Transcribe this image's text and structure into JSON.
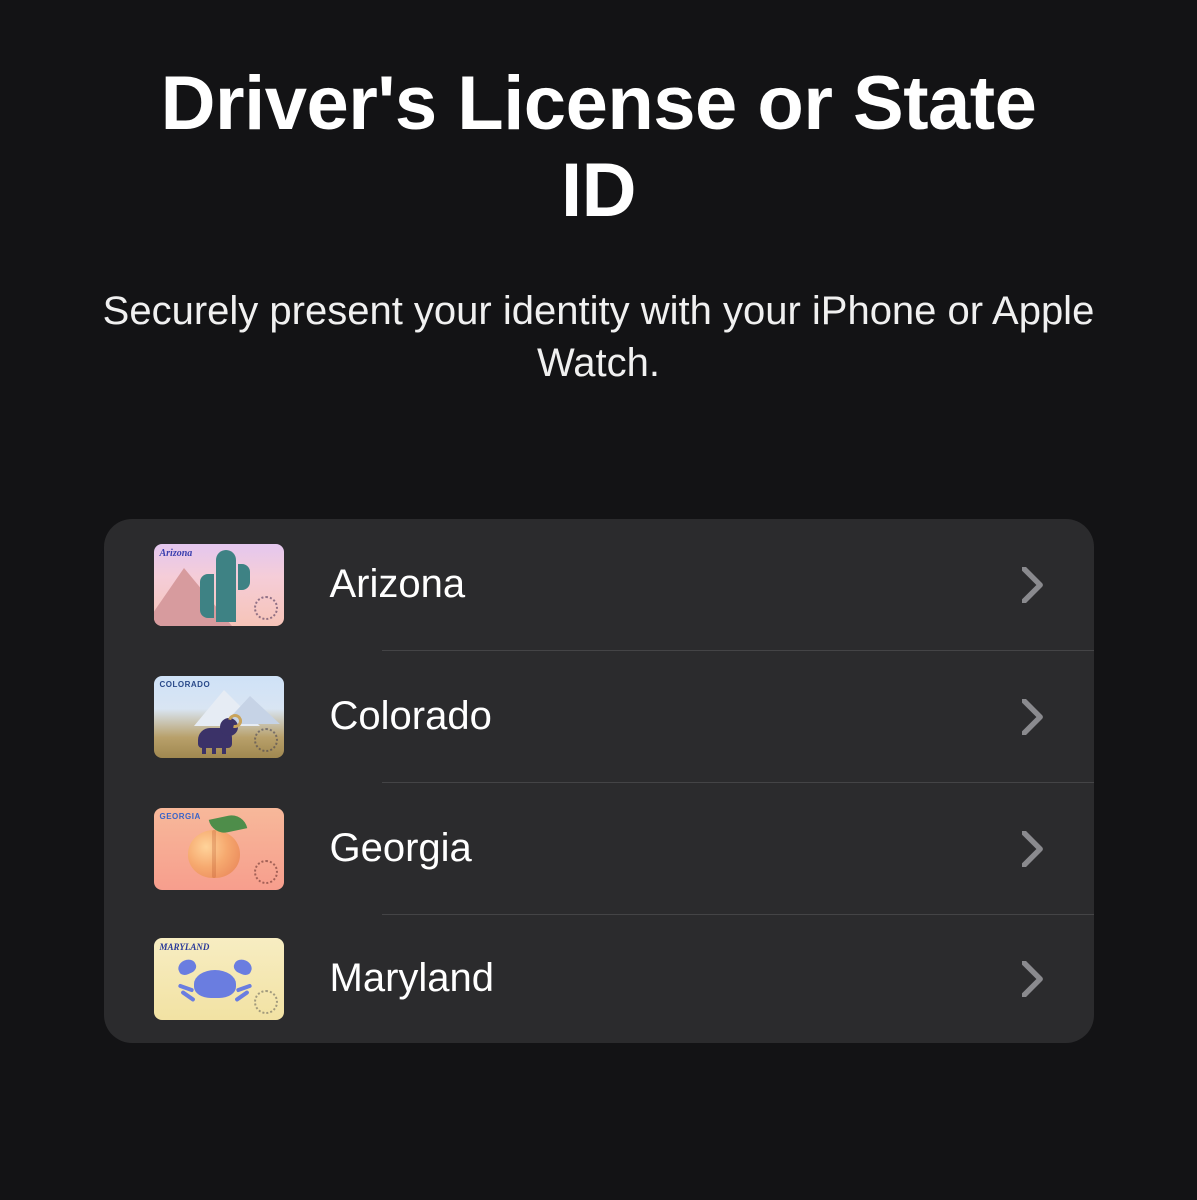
{
  "header": {
    "title": "Driver's License or State ID",
    "subtitle": "Securely present your identity with your iPhone or Apple Watch."
  },
  "states": [
    {
      "name": "Arizona",
      "card_label": "Arizona",
      "icon": "arizona"
    },
    {
      "name": "Colorado",
      "card_label": "COLORADO",
      "icon": "colorado"
    },
    {
      "name": "Georgia",
      "card_label": "GEORGIA",
      "icon": "georgia"
    },
    {
      "name": "Maryland",
      "card_label": "MARYLAND",
      "icon": "maryland"
    }
  ],
  "colors": {
    "background": "#131315",
    "panel": "#2b2b2d",
    "chevron": "#8a8a8e"
  }
}
